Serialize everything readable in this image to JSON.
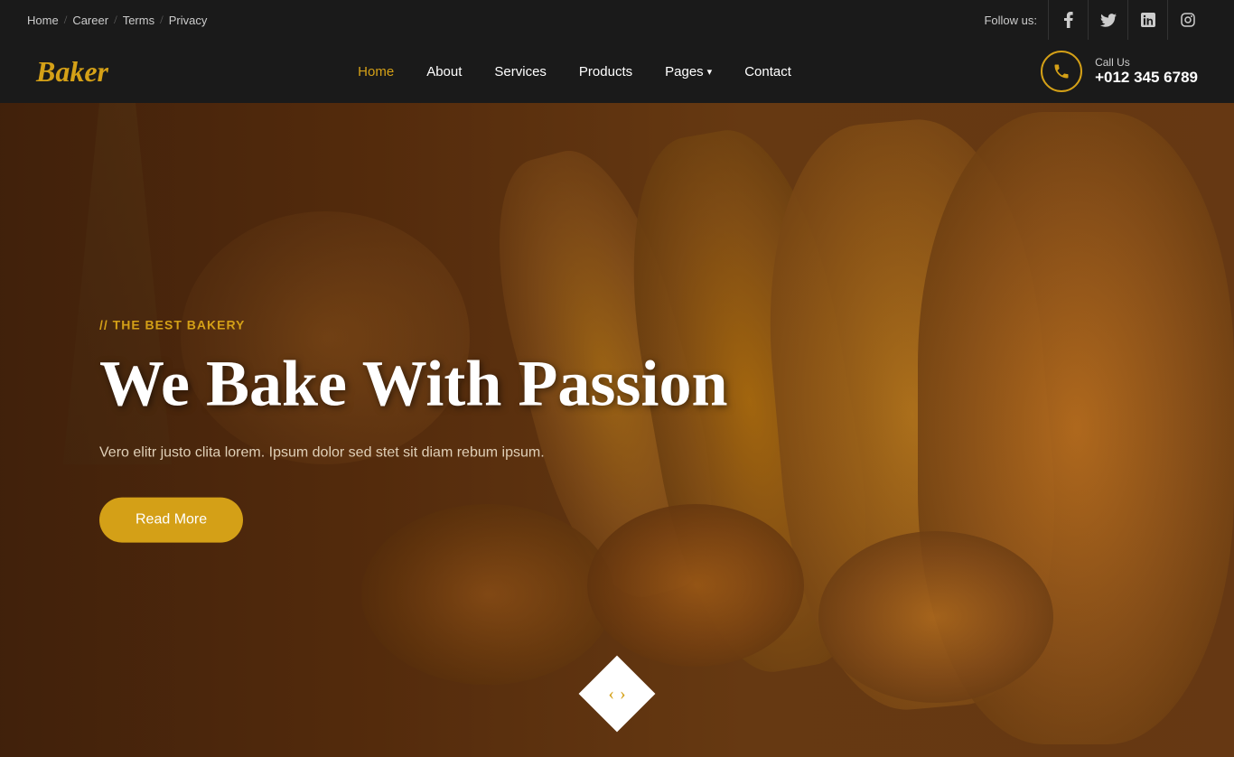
{
  "topbar": {
    "links": [
      {
        "label": "Home",
        "id": "home"
      },
      {
        "label": "Career",
        "id": "career"
      },
      {
        "label": "Terms",
        "id": "terms"
      },
      {
        "label": "Privacy",
        "id": "privacy"
      }
    ],
    "follow_label": "Follow us:",
    "social": [
      {
        "name": "facebook",
        "icon": "f"
      },
      {
        "name": "twitter",
        "icon": "t"
      },
      {
        "name": "linkedin",
        "icon": "in"
      },
      {
        "name": "instagram",
        "icon": "ig"
      }
    ]
  },
  "navbar": {
    "logo": "Baker",
    "links": [
      {
        "label": "Home",
        "active": true
      },
      {
        "label": "About",
        "active": false
      },
      {
        "label": "Services",
        "active": false
      },
      {
        "label": "Products",
        "active": false
      },
      {
        "label": "Pages",
        "active": false,
        "has_dropdown": true
      },
      {
        "label": "Contact",
        "active": false
      }
    ],
    "call_us_label": "Call Us",
    "phone": "+012 345 6789"
  },
  "hero": {
    "subtitle": "// THE BEST BAKERY",
    "title": "We Bake With Passion",
    "description": "Vero elitr justo clita lorem. Ipsum dolor sed stet sit diam rebum ipsum.",
    "cta_label": "Read More"
  },
  "colors": {
    "gold": "#d4a017",
    "dark": "#1a1a1a",
    "white": "#ffffff"
  }
}
